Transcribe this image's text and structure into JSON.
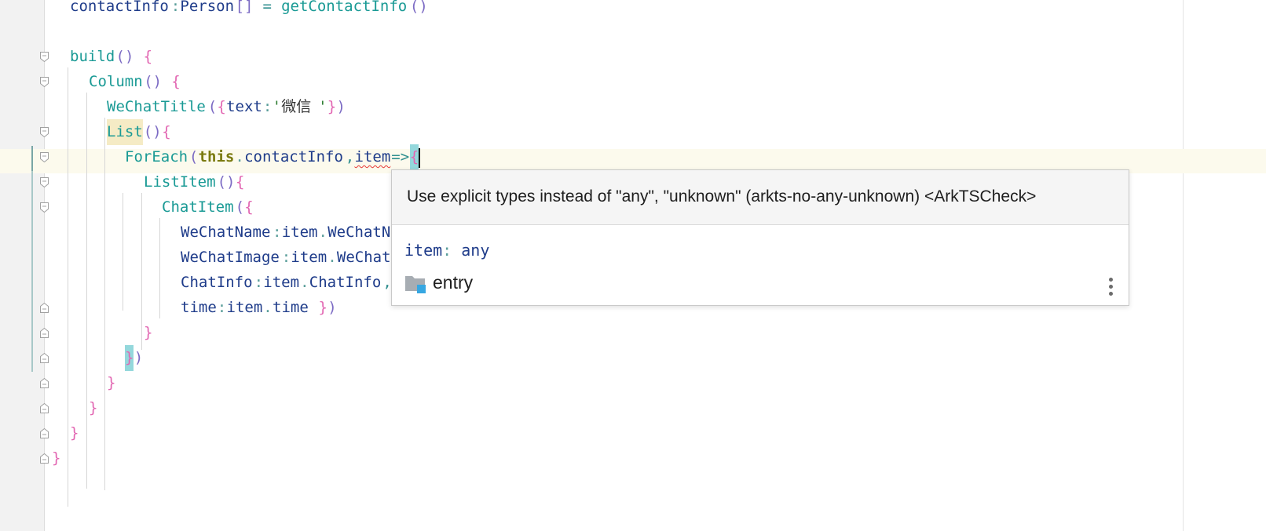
{
  "editor": {
    "lines": [
      [
        {
          "t": "contactInfo",
          "c": "field"
        },
        {
          "t": ":",
          "c": "punct"
        },
        {
          "t": "Person",
          "c": "type"
        },
        {
          "t": "[]",
          "c": "paren"
        },
        {
          "t": " = ",
          "c": "op"
        },
        {
          "t": "getContactInfo",
          "c": "func"
        },
        {
          "t": "()",
          "c": "paren"
        }
      ],
      [],
      [
        {
          "t": "build",
          "c": "func"
        },
        {
          "t": "()",
          "c": "paren"
        },
        {
          "t": " ",
          "c": "op"
        },
        {
          "t": "{",
          "c": "brace"
        }
      ],
      [
        {
          "t": "Column",
          "c": "func"
        },
        {
          "t": "()",
          "c": "paren"
        },
        {
          "t": " ",
          "c": "op"
        },
        {
          "t": "{",
          "c": "brace"
        }
      ],
      [
        {
          "t": "WeChatTitle",
          "c": "func"
        },
        {
          "t": "(",
          "c": "paren"
        },
        {
          "t": "{",
          "c": "brace"
        },
        {
          "t": "text",
          "c": "field"
        },
        {
          "t": ":",
          "c": "punct"
        },
        {
          "t": "'",
          "c": "str"
        },
        {
          "t": "微信",
          "c": "cjk"
        },
        {
          "t": "'",
          "c": "str"
        },
        {
          "t": "}",
          "c": "brace"
        },
        {
          "t": ")",
          "c": "paren"
        }
      ],
      [
        {
          "t": "List",
          "c": "func",
          "hl": "list"
        },
        {
          "t": "()",
          "c": "paren"
        },
        {
          "t": "{",
          "c": "brace"
        }
      ],
      [
        {
          "t": "ForEach",
          "c": "func"
        },
        {
          "t": "(",
          "c": "paren"
        },
        {
          "t": "this",
          "c": "kw"
        },
        {
          "t": ".",
          "c": "punct"
        },
        {
          "t": "contactInfo",
          "c": "dim"
        },
        {
          "t": ",",
          "c": "op"
        },
        {
          "t": "item",
          "c": "dim",
          "squiggle": true
        },
        {
          "t": "=>",
          "c": "op"
        },
        {
          "t": "{",
          "c": "brace",
          "hl": "brace"
        }
      ],
      [
        {
          "t": "ListItem",
          "c": "func"
        },
        {
          "t": "()",
          "c": "paren"
        },
        {
          "t": "{",
          "c": "brace"
        }
      ],
      [
        {
          "t": "ChatItem",
          "c": "func"
        },
        {
          "t": "(",
          "c": "paren"
        },
        {
          "t": "{",
          "c": "brace"
        }
      ],
      [
        {
          "t": "WeChatName",
          "c": "field"
        },
        {
          "t": ":",
          "c": "punct"
        },
        {
          "t": "item",
          "c": "dim"
        },
        {
          "t": ".",
          "c": "punct"
        },
        {
          "t": "WeChatN",
          "c": "dim"
        }
      ],
      [
        {
          "t": "WeChatImage",
          "c": "field"
        },
        {
          "t": ":",
          "c": "punct"
        },
        {
          "t": "item",
          "c": "dim"
        },
        {
          "t": ".",
          "c": "punct"
        },
        {
          "t": "WeChat",
          "c": "dim"
        }
      ],
      [
        {
          "t": "ChatInfo",
          "c": "field"
        },
        {
          "t": ":",
          "c": "punct"
        },
        {
          "t": "item",
          "c": "dim"
        },
        {
          "t": ".",
          "c": "punct"
        },
        {
          "t": "ChatInfo",
          "c": "dim"
        },
        {
          "t": ",",
          "c": "op"
        }
      ],
      [
        {
          "t": "time",
          "c": "field"
        },
        {
          "t": ":",
          "c": "punct"
        },
        {
          "t": "item",
          "c": "dim"
        },
        {
          "t": ".",
          "c": "punct"
        },
        {
          "t": "time",
          "c": "dim"
        },
        {
          "t": " ",
          "c": "op"
        },
        {
          "t": "}",
          "c": "brace"
        },
        {
          "t": ")",
          "c": "paren"
        }
      ],
      [
        {
          "t": "}",
          "c": "brace"
        }
      ],
      [
        {
          "t": "}",
          "c": "brace",
          "hl": "brace"
        },
        {
          "t": ")",
          "c": "paren"
        }
      ],
      [
        {
          "t": "}",
          "c": "brace"
        }
      ],
      [
        {
          "t": "}",
          "c": "brace"
        }
      ],
      [
        {
          "t": "}",
          "c": "brace"
        }
      ],
      [
        {
          "t": "}",
          "c": "brace"
        }
      ]
    ]
  },
  "popup": {
    "message": "Use explicit types instead of \"any\", \"unknown\" (arkts-no-any-unknown) <ArkTSCheck>",
    "signature_name": "item",
    "signature_colon": ":",
    "signature_type": "any",
    "module": "entry",
    "folder_icon": "module-folder-icon",
    "more_icon": "more-vertical-icon"
  }
}
